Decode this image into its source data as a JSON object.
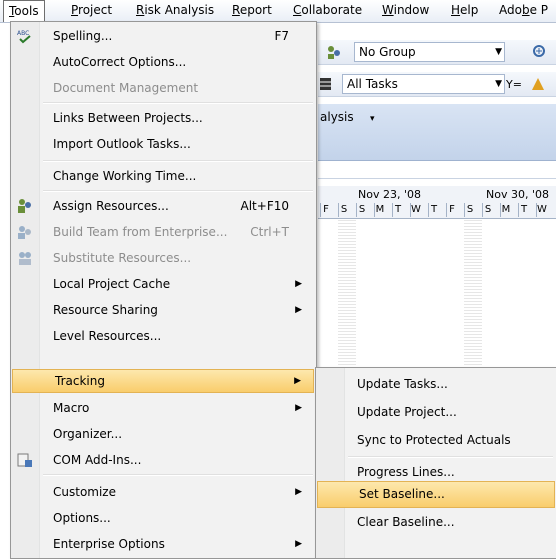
{
  "menubar": {
    "items": [
      {
        "label": "Tools",
        "u": "T"
      },
      {
        "label": "Project",
        "u": "P"
      },
      {
        "label": "Risk Analysis",
        "u": "R"
      },
      {
        "label": "Report",
        "u": "R"
      },
      {
        "label": "Collaborate",
        "u": "C"
      },
      {
        "label": "Window",
        "u": "W"
      },
      {
        "label": "Help",
        "u": "H"
      },
      {
        "label": "Adobe P",
        "u": "b"
      }
    ]
  },
  "toolbar": {
    "group_combo": "No Group",
    "filter_combo": "All Tasks",
    "analysis_label": "alysis"
  },
  "timescale": {
    "week1": "Nov 23, '08",
    "week2": "Nov 30, '08",
    "days": [
      "F",
      "S",
      "S",
      "M",
      "T",
      "W",
      "T",
      "F",
      "S",
      "S",
      "M",
      "T",
      "W"
    ]
  },
  "tools_menu": {
    "spelling": {
      "label": "Spelling...",
      "shortcut": "F7"
    },
    "autocorrect": {
      "label": "AutoCorrect Options..."
    },
    "document_management": {
      "label": "Document Management"
    },
    "links_between_projects": {
      "label": "Links Between Projects..."
    },
    "import_outlook": {
      "label": "Import Outlook Tasks..."
    },
    "change_working_time": {
      "label": "Change Working Time..."
    },
    "assign_resources": {
      "label": "Assign Resources...",
      "shortcut": "Alt+F10"
    },
    "build_team": {
      "label": "Build Team from Enterprise...",
      "shortcut": "Ctrl+T"
    },
    "substitute_resources": {
      "label": "Substitute Resources..."
    },
    "local_project_cache": {
      "label": "Local Project Cache"
    },
    "resource_sharing": {
      "label": "Resource Sharing"
    },
    "level_resources": {
      "label": "Level Resources..."
    },
    "tracking": {
      "label": "Tracking"
    },
    "macro": {
      "label": "Macro"
    },
    "organizer": {
      "label": "Organizer..."
    },
    "com_addins": {
      "label": "COM Add-Ins..."
    },
    "customize": {
      "label": "Customize"
    },
    "options": {
      "label": "Options..."
    },
    "enterprise_options": {
      "label": "Enterprise Options"
    }
  },
  "tracking_submenu": {
    "update_tasks": "Update Tasks...",
    "update_project": "Update Project...",
    "sync_protected": "Sync to Protected Actuals",
    "progress_lines": "Progress Lines...",
    "set_baseline": "Set Baseline...",
    "clear_baseline": "Clear Baseline..."
  }
}
